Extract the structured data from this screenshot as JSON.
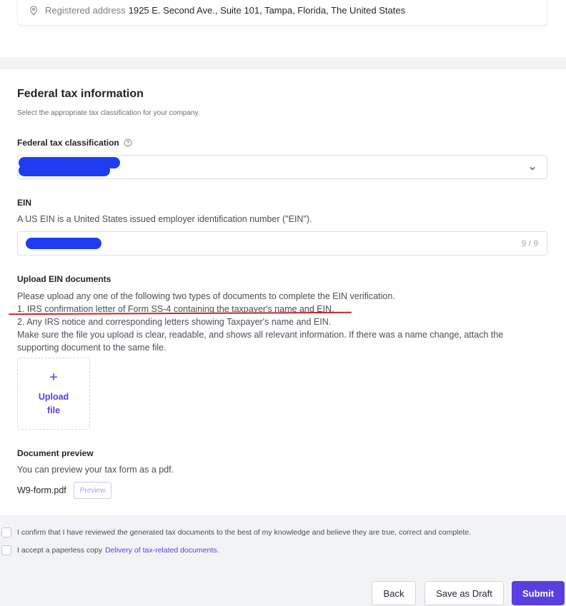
{
  "address": {
    "label": "Registered address",
    "value": "1925 E. Second Ave., Suite 101, Tampa, Florida, The United States"
  },
  "tax": {
    "title": "Federal tax information",
    "subtitle": "Select the appropriate tax classification for your company.",
    "classification_label": "Federal tax classification",
    "ein_label": "EIN",
    "ein_helper": "A US EIN is a United States issued employer identification number (\"EIN\").",
    "ein_counter": "9 / 9",
    "upload_title": "Upload EIN documents",
    "upload_lines": [
      "Please upload any one of the following two types of documents to complete the EIN verification.",
      "1. IRS confirmation letter of Form SS-4 containing the taxpayer's name and EIN.",
      "2. Any IRS notice and corresponding letters showing Taxpayer's name and EIN.",
      "Make sure the file you upload is clear, readable, and shows all relevant information. If there was a name change, attach the supporting document to the same file."
    ],
    "upload_button": "Upload file",
    "preview_title": "Document preview",
    "preview_helper": "You can preview your tax form as a pdf.",
    "file_name": "W9-form.pdf",
    "preview_button": "Preview"
  },
  "confirm": {
    "reviewed": "I confirm that I have reviewed the generated tax documents to the best of my knowledge and believe they are true, correct and complete.",
    "paperless_prefix": "I accept a paperless copy",
    "paperless_link": "Delivery of tax-related documents."
  },
  "actions": {
    "back": "Back",
    "save_draft": "Save as Draft",
    "submit": "Submit"
  },
  "colors": {
    "accent": "#5a3fe0",
    "redaction": "#1f3df0",
    "annotation_underline": "#c8242b"
  },
  "icons": {
    "address": "location-pin-icon",
    "help": "help-circle-icon",
    "select": "chevron-down-icon",
    "upload": "plus-icon"
  }
}
